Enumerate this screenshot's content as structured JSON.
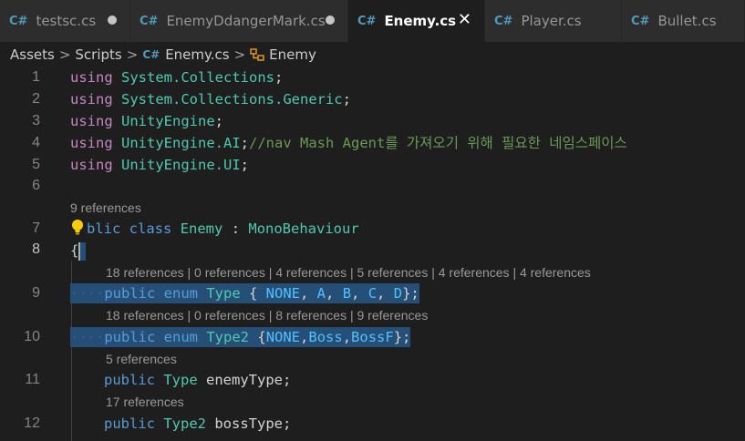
{
  "tabs": [
    {
      "label": "testsc.cs",
      "icon": "csharp-file-icon",
      "state": "modified"
    },
    {
      "label": "EnemyDdangerMark.cs",
      "icon": "csharp-file-icon",
      "state": "modified"
    },
    {
      "label": "Enemy.cs",
      "icon": "csharp-file-icon",
      "state": "active"
    },
    {
      "label": "Player.cs",
      "icon": "csharp-file-icon",
      "state": "normal"
    },
    {
      "label": "Bullet.cs",
      "icon": "csharp-file-icon",
      "state": "normal"
    }
  ],
  "tab_icon_glyph": "C#",
  "close_glyph": "✕",
  "breadcrumb": {
    "items": [
      "Assets",
      "Scripts",
      "Enemy.cs",
      "Enemy"
    ],
    "separator": ">"
  },
  "editor": {
    "line_numbers": [
      "1",
      "2",
      "3",
      "4",
      "5",
      "6",
      "7",
      "8",
      "9",
      "10",
      "11",
      "12"
    ],
    "codelens": {
      "class": "9 references",
      "enum_type": "18 references | 0 references | 4 references | 5 references | 4 references | 4 references",
      "enum_type2": "18 references | 0 references | 8 references | 9 references",
      "enemy_type": "5 references",
      "boss_type": "17 references"
    },
    "code": {
      "l1_kw": "using",
      "l1_ns": "System.Collections",
      "l1_end": ";",
      "l2_kw": "using",
      "l2_ns": "System.Collections.Generic",
      "l2_end": ";",
      "l3_kw": "using",
      "l3_ns": "UnityEngine",
      "l3_end": ";",
      "l4_kw": "using",
      "l4_ns": "UnityEngine.AI",
      "l4_end": ";",
      "l4_comment": "//nav Mash Agent를 가져오기 위해 필요한 네임스페이스",
      "l5_kw": "using",
      "l5_ns": "UnityEngine.UI",
      "l5_end": ";",
      "l7_a": "blic",
      "l7_b": "class",
      "l7_c": "Enemy",
      "l7_d": " : ",
      "l7_e": "MonoBehaviour",
      "l8": "{",
      "l9_ws": "····",
      "l9_a": "public",
      "l9_b": "enum",
      "l9_c": "Type",
      "l9_d": " { ",
      "l9_e": "NONE",
      "l9_f": ", ",
      "l9_g": "A",
      "l9_h": ", ",
      "l9_i": "B",
      "l9_j": ", ",
      "l9_k": "C",
      "l9_l": ", ",
      "l9_m": "D",
      "l9_n": "};",
      "l10_ws": "····",
      "l10_a": "public",
      "l10_b": "enum",
      "l10_c": "Type2",
      "l10_d": " {",
      "l10_e": "NONE",
      "l10_f": ",",
      "l10_g": "Boss",
      "l10_h": ",",
      "l10_i": "BossF",
      "l10_j": "};",
      "l11_a": "public",
      "l11_b": "Type",
      "l11_c": " enemyType;",
      "l12_a": "public",
      "l12_b": "Type2",
      "l12_c": " bossType;"
    }
  },
  "colors": {
    "editor_bg": "#1e1e1e",
    "tabbar_bg": "#252526",
    "keyword": "#c586c0",
    "namespace": "#4ec9b0",
    "comment": "#6a9955",
    "selection": "#264f78",
    "cs_icon": "#519aba"
  }
}
